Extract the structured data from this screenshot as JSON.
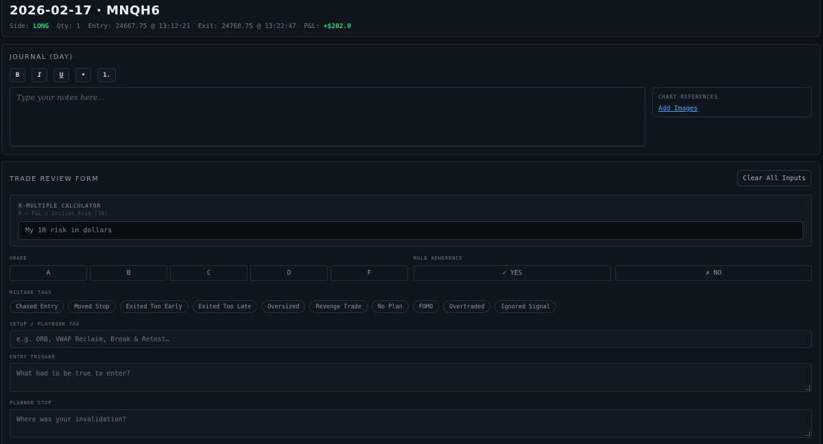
{
  "header": {
    "title": "2026-02-17 · MNQH6",
    "side_label": "Side:",
    "side_value": "LONG",
    "qty_label": "Qty:",
    "qty_value": "1",
    "entry_label": "Entry:",
    "entry_value": "24667.75 @ 13:12:21",
    "exit_label": "Exit:",
    "exit_value": "24768.75 @ 13:22:47",
    "pnl_label": "P&L:",
    "pnl_value": "+$202.0"
  },
  "journal": {
    "title": "JOURNAL (DAY)",
    "toolbar": [
      {
        "label": "B",
        "icon": "bold-icon"
      },
      {
        "label": "I",
        "icon": "italic-icon"
      },
      {
        "label": "U",
        "icon": "underline-icon"
      },
      {
        "label": "•",
        "icon": "bullet-list-icon"
      },
      {
        "label": "1.",
        "icon": "numbered-list-icon"
      }
    ],
    "notes_placeholder": "Type your notes here...",
    "chart_refs_label": "CHART REFERENCES",
    "add_images_label": "Add Images"
  },
  "review": {
    "title": "TRADE REVIEW FORM",
    "clear_label": "Clear All Inputs",
    "rcalc_title": "R-MULTIPLE CALCULATOR",
    "rcalc_formula": "R = P&L ÷ Initial Risk (1R)",
    "rcalc_placeholder": "My 1R risk in dollars",
    "grade_label": "GRADE",
    "grades": [
      "A",
      "B",
      "C",
      "D",
      "F"
    ],
    "rule_label": "RULE ADHERENCE",
    "rule_yes": "✓ YES",
    "rule_no": "✗ NO",
    "mistake_label": "MISTAKE TAGS",
    "mistake_tags": [
      "Chased Entry",
      "Moved Stop",
      "Exited Too Early",
      "Exited Too Late",
      "Oversized",
      "Revenge Trade",
      "No Plan",
      "FOMO",
      "Overtraded",
      "Ignored Signal"
    ],
    "setup_label": "SETUP / PLAYBOOK TAG",
    "setup_placeholder": "e.g. ORB, VWAP Reclaim, Break & Retest…",
    "trigger_label": "ENTRY TRIGGER",
    "trigger_placeholder": "What had to be true to enter?",
    "stop_label": "PLANNED STOP",
    "stop_placeholder": "Where was your invalidation?"
  },
  "colors": {
    "background": "#0b1117",
    "accent_green": "#22d17a",
    "link_blue": "#4da6ff"
  }
}
